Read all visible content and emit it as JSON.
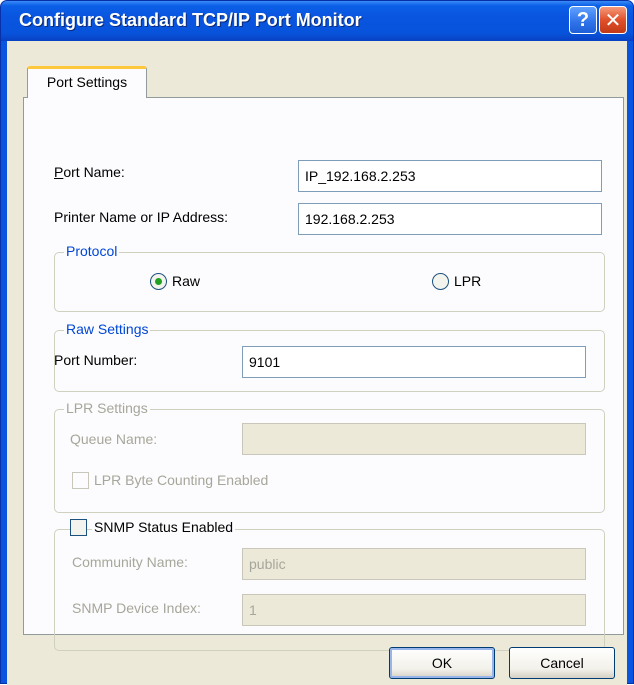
{
  "window": {
    "title": "Configure Standard TCP/IP Port Monitor"
  },
  "titlebar": {
    "help_glyph": "?",
    "close_glyph": "✕"
  },
  "tabs": [
    {
      "label": "Port Settings"
    }
  ],
  "port_name": {
    "label": "Port Name:",
    "value": "IP_192.168.2.253"
  },
  "printer_address": {
    "label": "Printer Name or IP Address:",
    "value": "192.168.2.253"
  },
  "protocol": {
    "legend": "Protocol",
    "options": [
      {
        "label": "Raw",
        "selected": true
      },
      {
        "label": "LPR",
        "selected": false
      }
    ]
  },
  "raw_settings": {
    "legend": "Raw Settings",
    "port_number_label": "Port Number:",
    "port_number_value": "9101"
  },
  "lpr_settings": {
    "legend": "LPR Settings",
    "queue_name_label": "Queue Name:",
    "queue_name_value": "",
    "byte_counting_label": "LPR Byte Counting Enabled",
    "byte_counting_checked": false
  },
  "snmp": {
    "enabled_label": "SNMP Status Enabled",
    "enabled_checked": false,
    "community_label": "Community Name:",
    "community_value": "public",
    "device_index_label": "SNMP Device Index:",
    "device_index_value": "1"
  },
  "buttons": {
    "ok": "OK",
    "cancel": "Cancel"
  },
  "colors": {
    "titlebar": "#0a55e0",
    "dialog_bg": "#ece9d8",
    "panel_bg": "#fcfcfe",
    "groupbox_title": "#0046d5",
    "disabled_text": "#a7a69a"
  }
}
